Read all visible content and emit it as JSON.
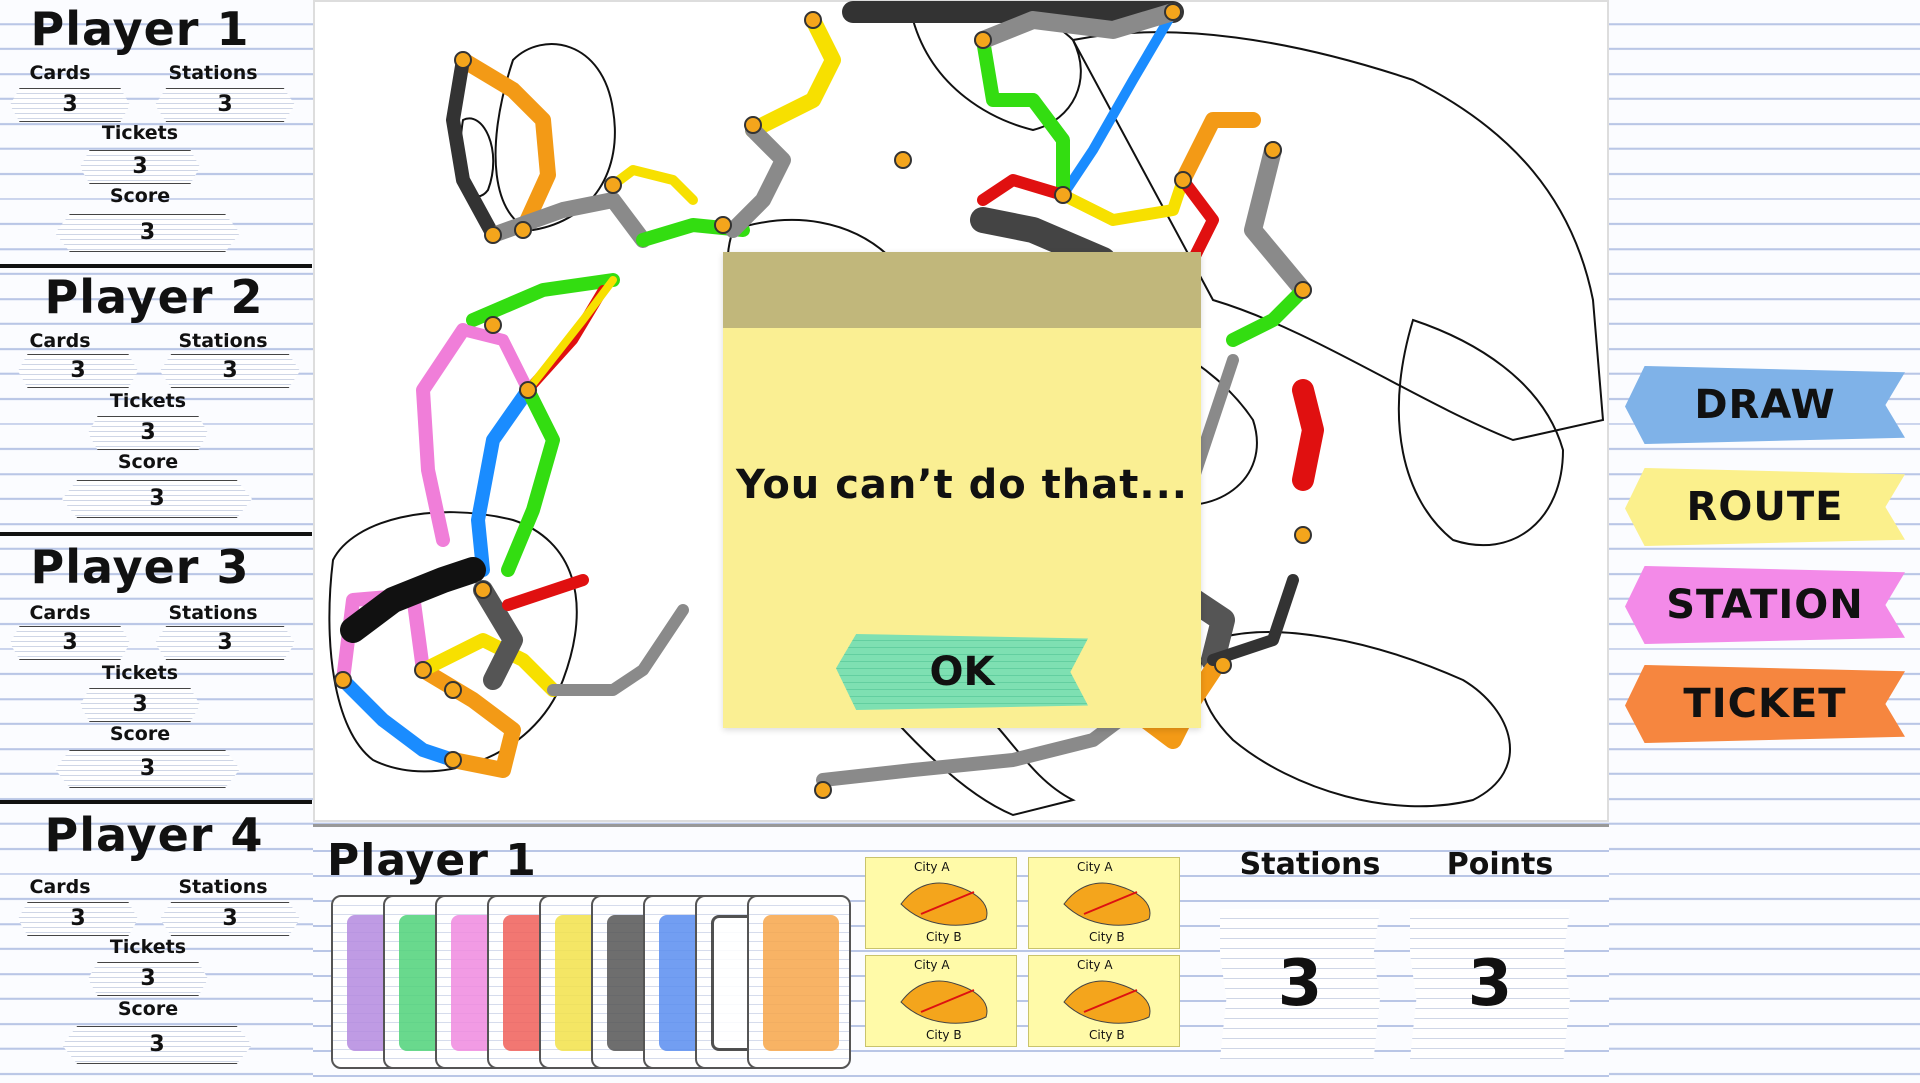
{
  "players": [
    {
      "name": "Player 1",
      "cards_label": "Cards",
      "cards": "3",
      "stations_label": "Stations",
      "stations": "3",
      "tickets_label": "Tickets",
      "tickets": "3",
      "score_label": "Score",
      "score": "3"
    },
    {
      "name": "Player 2",
      "cards_label": "Cards",
      "cards": "3",
      "stations_label": "Stations",
      "stations": "3",
      "tickets_label": "Tickets",
      "tickets": "3",
      "score_label": "Score",
      "score": "3"
    },
    {
      "name": "Player 3",
      "cards_label": "Cards",
      "cards": "3",
      "stations_label": "Stations",
      "stations": "3",
      "tickets_label": "Tickets",
      "tickets": "3",
      "score_label": "Score",
      "score": "3"
    },
    {
      "name": "Player 4",
      "cards_label": "Cards",
      "cards": "3",
      "stations_label": "Stations",
      "stations": "3",
      "tickets_label": "Tickets",
      "tickets": "3",
      "score_label": "Score",
      "score": "3"
    }
  ],
  "actions": {
    "draw": "DRAW",
    "route": "ROUTE",
    "station": "STATION",
    "ticket": "TICKET"
  },
  "hand": {
    "title": "Player 1",
    "train_cards": [
      {
        "color": "purple",
        "hex": "#b48ae0"
      },
      {
        "color": "green",
        "hex": "#4fd37a"
      },
      {
        "color": "pink",
        "hex": "#f08ae0"
      },
      {
        "color": "red",
        "hex": "#f0605a"
      },
      {
        "color": "yellow",
        "hex": "#f3e24a"
      },
      {
        "color": "black",
        "hex": "#555555"
      },
      {
        "color": "blue",
        "hex": "#5a8ef0"
      },
      {
        "color": "white",
        "hex": "#ffffff"
      },
      {
        "color": "orange",
        "hex": "#f7a64a"
      }
    ],
    "tickets": [
      {
        "city_a": "City A",
        "city_b": "City B"
      },
      {
        "city_a": "City A",
        "city_b": "City B"
      },
      {
        "city_a": "City A",
        "city_b": "City B"
      },
      {
        "city_a": "City A",
        "city_b": "City B"
      }
    ],
    "stations_label": "Stations",
    "stations": "3",
    "points_label": "Points",
    "points": "3"
  },
  "dialog": {
    "message": "You can’t do that...",
    "ok_label": "OK"
  },
  "colors": {
    "blue": "#1a8cff",
    "green": "#33dd11",
    "red": "#e01010",
    "yellow": "#f7e000",
    "orange": "#f39a16",
    "pink": "#f07ed9",
    "black": "#333333",
    "gray": "#8a8a8a",
    "city": "#f4a51c"
  }
}
